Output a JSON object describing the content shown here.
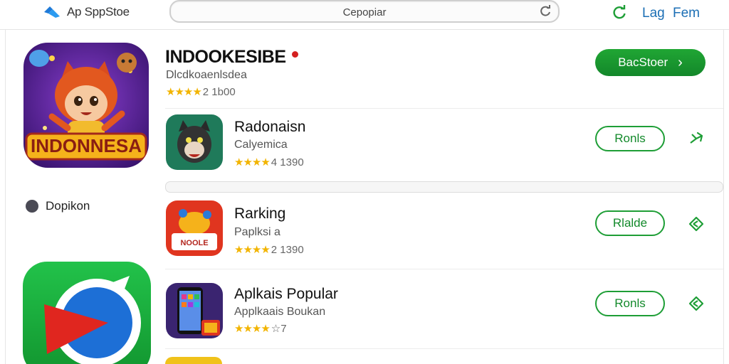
{
  "header": {
    "brand": "Ap SppStoe",
    "search_value": "Cepopiar",
    "link1": "Lag",
    "link2": "Fem"
  },
  "sidebar": {
    "label": "Dopikon"
  },
  "featured": {
    "title": "INDOOKESIBE",
    "subtitle": "Dlcdkoaenlsdea",
    "stars": "★★★★",
    "rating_text": "2 1b00",
    "button": "BacStoer",
    "button_chevron": "›"
  },
  "apps": [
    {
      "title": "Radonaisn",
      "subtitle": "Calyemica",
      "stars": "★★★★",
      "rating_text": "4 1390",
      "button": "Ronls"
    },
    {
      "title": "Rarking",
      "subtitle": "Paplksi a",
      "stars": "★★★★",
      "rating_text": "2 1390",
      "button": "Rlalde"
    },
    {
      "title": "Aplkais Popular",
      "subtitle": "Applkaais Boukan",
      "stars": "★★★★",
      "rating_text": "☆7",
      "button": "Ronls"
    }
  ],
  "colors": {
    "accent_green": "#1e9e36",
    "link_blue": "#1c6fb5",
    "star": "#f2b400"
  },
  "icons": [
    "brand-logo-icon",
    "refresh-icon",
    "share-arrow-icon",
    "app-icon"
  ]
}
